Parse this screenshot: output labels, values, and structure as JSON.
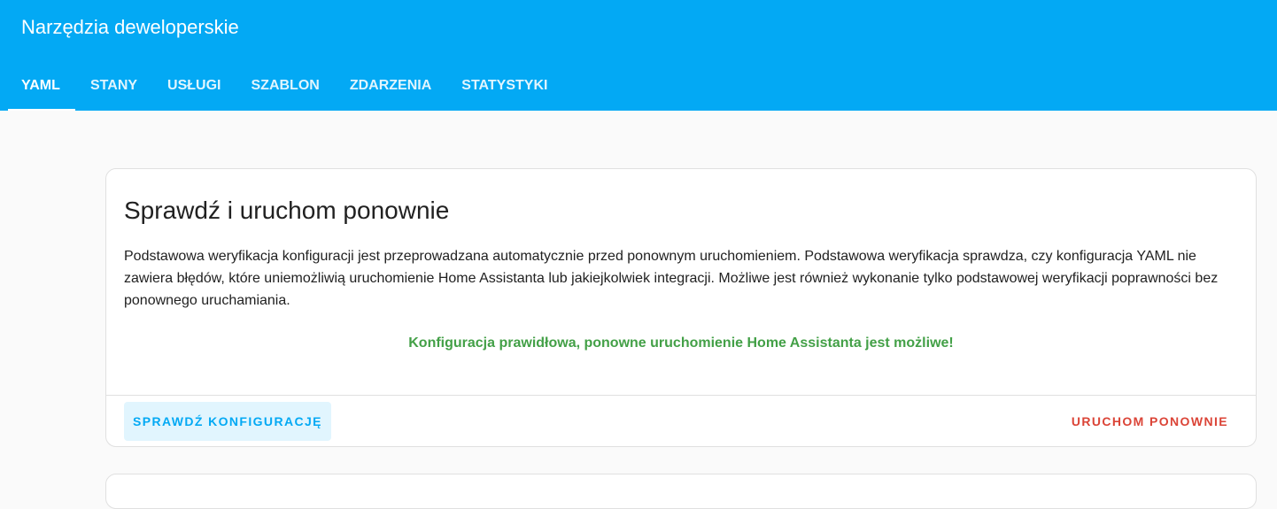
{
  "header": {
    "title": "Narzędzia deweloperskie",
    "tabs": [
      {
        "label": "YAML",
        "active": true
      },
      {
        "label": "STANY",
        "active": false
      },
      {
        "label": "USŁUGI",
        "active": false
      },
      {
        "label": "SZABLON",
        "active": false
      },
      {
        "label": "ZDARZENIA",
        "active": false
      },
      {
        "label": "STATYSTYKI",
        "active": false
      }
    ]
  },
  "card": {
    "title": "Sprawdź i uruchom ponownie",
    "description": "Podstawowa weryfikacja konfiguracji jest przeprowadzana automatycznie przed ponownym uruchomieniem. Podstawowa weryfikacja sprawdza, czy konfiguracja YAML nie zawiera błędów, które uniemożliwią uruchomienie Home Assistanta lub jakiejkolwiek integracji. Możliwe jest również wykonanie tylko podstawowej weryfikacji poprawności bez ponownego uruchamiania.",
    "status": "Konfiguracja prawidłowa, ponowne uruchomienie Home Assistanta jest możliwe!",
    "check_button": "SPRAWDŹ KONFIGURACJĘ",
    "restart_button": "URUCHOM PONOWNIE"
  },
  "colors": {
    "header_bg": "#03a9f4",
    "status_ok": "#43a047",
    "restart": "#db4437",
    "check_button_bg": "#e1f5fe"
  }
}
